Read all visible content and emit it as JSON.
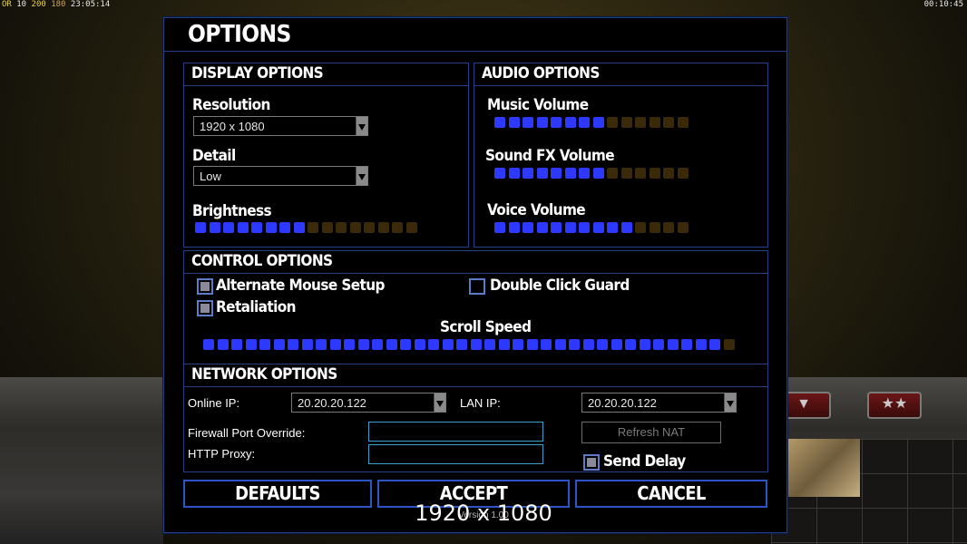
{
  "hud": {
    "top_left_prefix": "OR",
    "top_left_a": "10",
    "top_left_b": "200",
    "top_left_c": "180",
    "top_left_time": "23:05:14",
    "top_right_time": "00:10:45"
  },
  "window": {
    "title": "OPTIONS"
  },
  "display": {
    "header": "DISPLAY OPTIONS",
    "resolution_label": "Resolution",
    "resolution_value": "1920 x 1080",
    "detail_label": "Detail",
    "detail_value": "Low",
    "brightness_label": "Brightness",
    "brightness_level": 0.5
  },
  "audio": {
    "header": "AUDIO OPTIONS",
    "music_label": "Music Volume",
    "music_level": 0.57,
    "sfx_label": "Sound FX Volume",
    "sfx_level": 0.57,
    "voice_label": "Voice Volume",
    "voice_level": 0.71
  },
  "control": {
    "header": "CONTROL OPTIONS",
    "alt_mouse_label": "Alternate Mouse Setup",
    "alt_mouse_checked": true,
    "double_click_label": "Double Click Guard",
    "double_click_checked": false,
    "retaliation_label": "Retaliation",
    "retaliation_checked": true,
    "scroll_label": "Scroll Speed",
    "scroll_level": 0.97
  },
  "network": {
    "header": "NETWORK OPTIONS",
    "online_ip_label": "Online IP:",
    "online_ip_value": "20.20.20.122",
    "lan_ip_label": "LAN IP:",
    "lan_ip_value": "20.20.20.122",
    "firewall_label": "Firewall Port Override:",
    "firewall_value": "",
    "proxy_label": "HTTP Proxy:",
    "proxy_value": "",
    "refresh_nat_label": "Refresh NAT",
    "send_delay_label": "Send Delay",
    "send_delay_checked": true
  },
  "buttons": {
    "defaults": "DEFAULTS",
    "accept": "ACCEPT",
    "cancel": "CANCEL"
  },
  "overlay": {
    "resolution_text": "1920 x 1080",
    "version_text": "Version 1.00"
  }
}
